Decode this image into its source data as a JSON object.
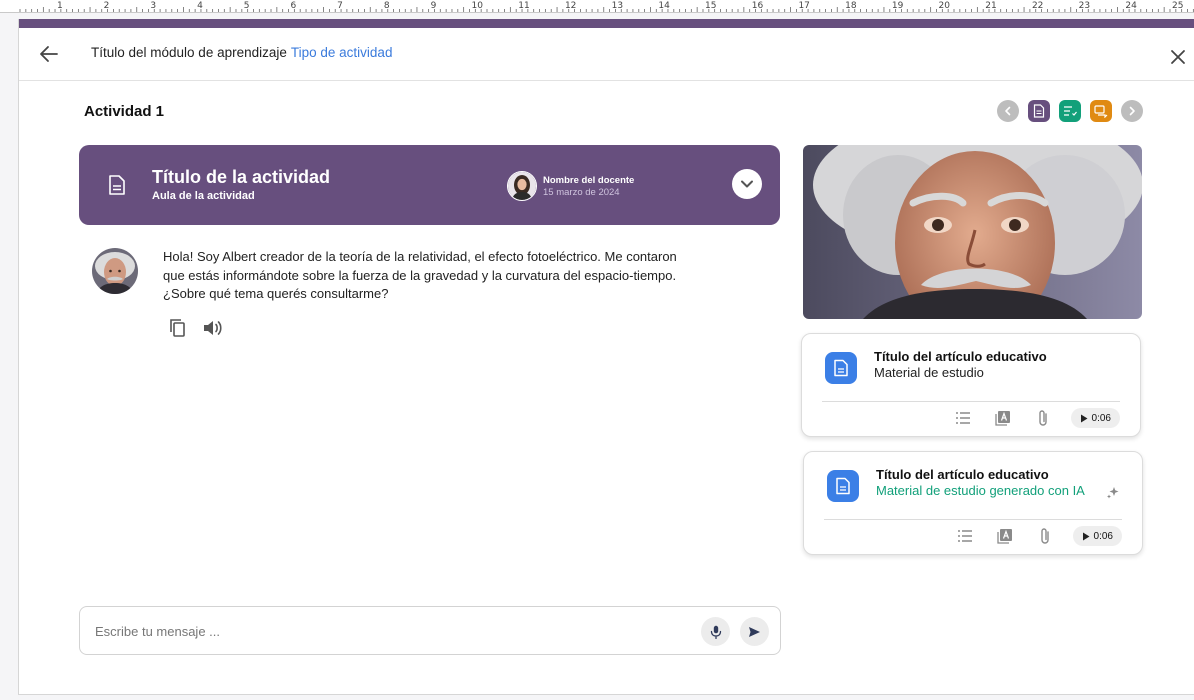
{
  "colors": {
    "accent_bar": "#674f7e",
    "activity_card_bg": "#674f7e",
    "link_blue": "#3b7bdc",
    "nav_purple": "#674f7e",
    "nav_green": "#12a07a",
    "nav_orange": "#e08a12",
    "resource_icon_blue": "#3b7fe6",
    "ai_green": "#12a07a"
  },
  "ruler": {
    "numbers": [
      "1",
      "2",
      "3",
      "4",
      "5",
      "6",
      "7",
      "8",
      "9",
      "10",
      "11",
      "12",
      "13",
      "14",
      "15",
      "16",
      "17",
      "18",
      "19",
      "20",
      "21",
      "22",
      "23",
      "24",
      "25"
    ]
  },
  "header": {
    "module_title": "Título del módulo de aprendizaje",
    "activity_type": "Tipo de actividad"
  },
  "activity_label": "Actividad 1",
  "nav": {
    "items": [
      {
        "icon": "chevron-left-icon"
      },
      {
        "icon": "document-icon"
      },
      {
        "icon": "checklist-icon"
      },
      {
        "icon": "chat-icon"
      },
      {
        "icon": "chevron-right-icon"
      }
    ]
  },
  "activity": {
    "title": "Título de la actividad",
    "subtitle": "Aula de la actividad",
    "teacher_name": "Nombre del docente",
    "date": "15 marzo de 2024"
  },
  "chat": {
    "message": "Hola! Soy Albert creador de la teoría de la relatividad, el efecto fotoeléctrico. Me contaron que estás informándote sobre la fuerza de la gravedad y la curvatura del espacio-tiempo. ¿Sobre qué tema querés consultarme?"
  },
  "composer": {
    "placeholder": "Escribe tu mensaje ..."
  },
  "resources": [
    {
      "title": "Título del artículo educativo",
      "subtitle": "Material de estudio",
      "audio_time": "0:06"
    },
    {
      "title": "Título del artículo educativo",
      "subtitle": "Material de estudio generado con IA",
      "audio_time": "0:06"
    }
  ]
}
